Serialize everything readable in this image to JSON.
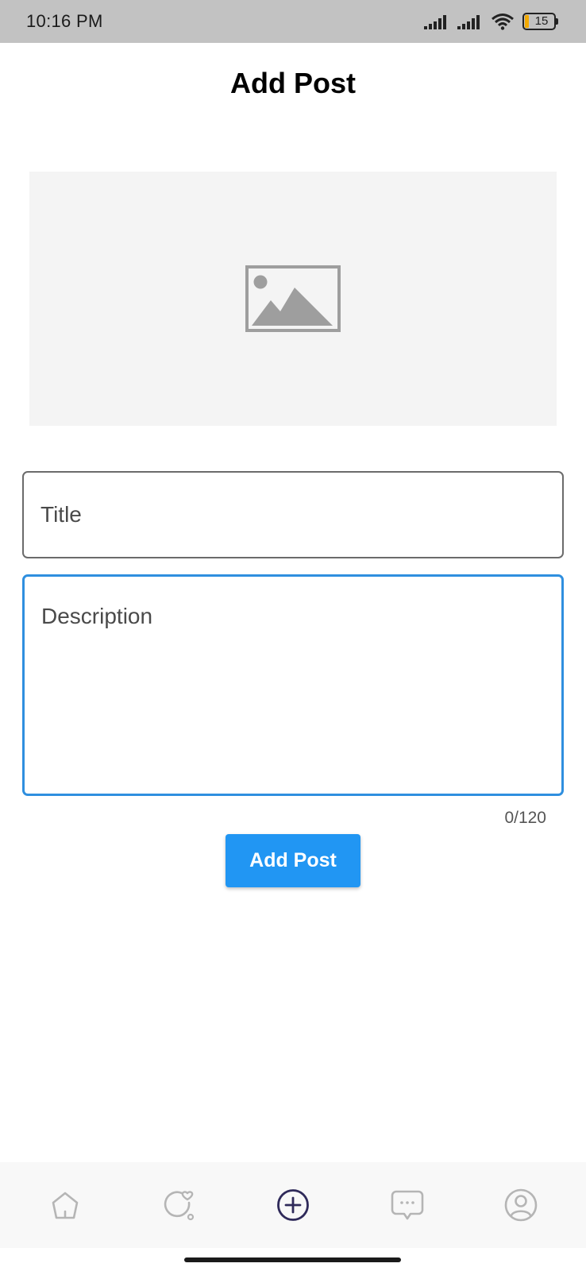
{
  "status_bar": {
    "time": "10:16 PM",
    "battery_level": "15",
    "icons": [
      "signal-icon",
      "signal-icon",
      "wifi-icon",
      "battery-icon"
    ]
  },
  "header": {
    "title": "Add Post"
  },
  "image_picker": {
    "icon": "image-placeholder-icon"
  },
  "form": {
    "title_placeholder": "Title",
    "title_value": "",
    "description_placeholder": "Description",
    "description_value": "",
    "char_counter": "0/120"
  },
  "actions": {
    "add_post_label": "Add Post"
  },
  "colors": {
    "accent": "#2196f3",
    "focused_border": "#2f8fdf",
    "nav_active": "#2f2a5a",
    "nav_inactive": "#b5b5b5"
  },
  "bottom_nav": {
    "items": [
      {
        "icon": "home-icon",
        "active": false
      },
      {
        "icon": "activity-icon",
        "active": false
      },
      {
        "icon": "add-circle-icon",
        "active": true
      },
      {
        "icon": "chat-icon",
        "active": false
      },
      {
        "icon": "profile-icon",
        "active": false
      }
    ]
  }
}
